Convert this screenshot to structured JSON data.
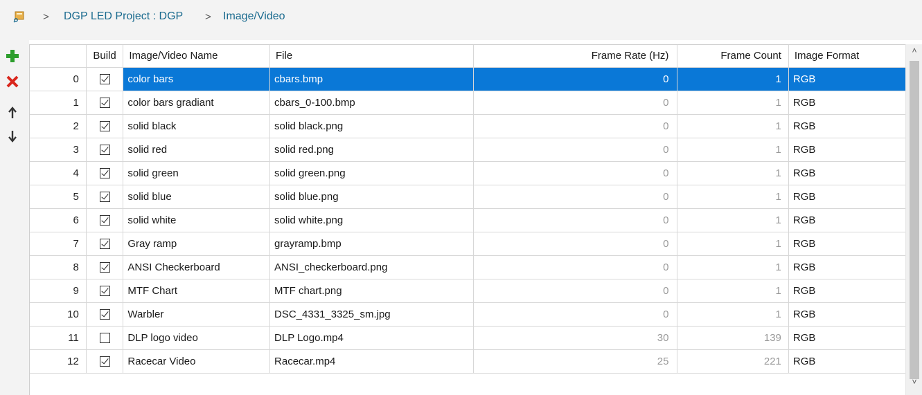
{
  "breadcrumb": {
    "items": [
      "DGP LED Project : DGP",
      "Image/Video"
    ],
    "separator": ">"
  },
  "toolbar": {
    "icons": [
      "add-icon",
      "delete-icon",
      "move-up-icon",
      "move-down-icon"
    ]
  },
  "table": {
    "columns": [
      "Build",
      "Image/Video Name",
      "File",
      "Frame Rate (Hz)",
      "Frame Count",
      "Image Format"
    ],
    "selected_row": 0,
    "rows": [
      {
        "index": "0",
        "build": true,
        "name": "color bars",
        "file": "cbars.bmp",
        "frame_rate": "0",
        "frame_count": "1",
        "format": "RGB"
      },
      {
        "index": "1",
        "build": true,
        "name": "color bars gradiant",
        "file": "cbars_0-100.bmp",
        "frame_rate": "0",
        "frame_count": "1",
        "format": "RGB"
      },
      {
        "index": "2",
        "build": true,
        "name": "solid black",
        "file": "solid black.png",
        "frame_rate": "0",
        "frame_count": "1",
        "format": "RGB"
      },
      {
        "index": "3",
        "build": true,
        "name": "solid red",
        "file": "solid red.png",
        "frame_rate": "0",
        "frame_count": "1",
        "format": "RGB"
      },
      {
        "index": "4",
        "build": true,
        "name": "solid green",
        "file": "solid green.png",
        "frame_rate": "0",
        "frame_count": "1",
        "format": "RGB"
      },
      {
        "index": "5",
        "build": true,
        "name": "solid blue",
        "file": "solid blue.png",
        "frame_rate": "0",
        "frame_count": "1",
        "format": "RGB"
      },
      {
        "index": "6",
        "build": true,
        "name": "solid white",
        "file": "solid white.png",
        "frame_rate": "0",
        "frame_count": "1",
        "format": "RGB"
      },
      {
        "index": "7",
        "build": true,
        "name": "Gray ramp",
        "file": "grayramp.bmp",
        "frame_rate": "0",
        "frame_count": "1",
        "format": "RGB"
      },
      {
        "index": "8",
        "build": true,
        "name": "ANSI Checkerboard",
        "file": "ANSI_checkerboard.png",
        "frame_rate": "0",
        "frame_count": "1",
        "format": "RGB"
      },
      {
        "index": "9",
        "build": true,
        "name": "MTF Chart",
        "file": "MTF chart.png",
        "frame_rate": "0",
        "frame_count": "1",
        "format": "RGB"
      },
      {
        "index": "10",
        "build": true,
        "name": "Warbler",
        "file": "DSC_4331_3325_sm.jpg",
        "frame_rate": "0",
        "frame_count": "1",
        "format": "RGB"
      },
      {
        "index": "11",
        "build": false,
        "name": "DLP logo video",
        "file": "DLP Logo.mp4",
        "frame_rate": "30",
        "frame_count": "139",
        "format": "RGB"
      },
      {
        "index": "12",
        "build": true,
        "name": "Racecar Video",
        "file": "Racecar.mp4",
        "frame_rate": "25",
        "frame_count": "221",
        "format": "RGB"
      }
    ]
  },
  "colors": {
    "selection": "#0a78d7",
    "link": "#1b6b8f",
    "add": "#2e9e2e",
    "delete": "#d9261c"
  }
}
